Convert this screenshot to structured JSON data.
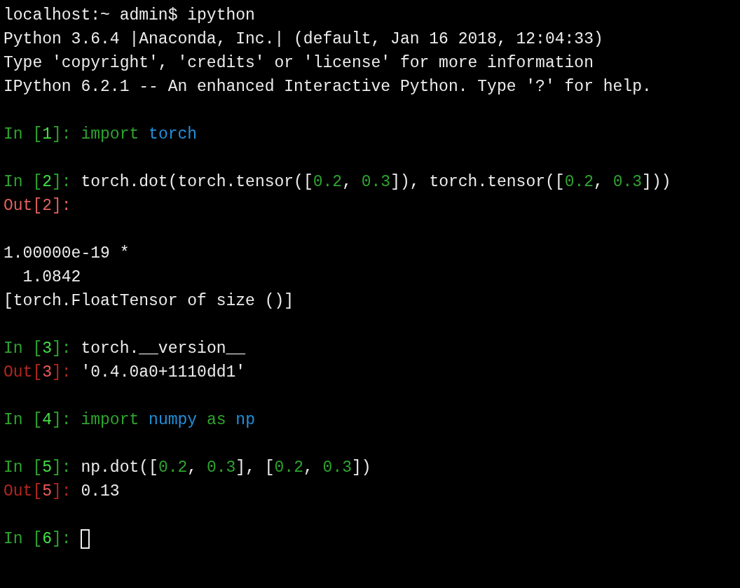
{
  "terminal": {
    "lines": [
      {
        "kind": "text",
        "segments": [
          {
            "kind": "plain",
            "text": "localhost:~ admin$ ipython"
          }
        ]
      },
      {
        "kind": "text",
        "segments": [
          {
            "kind": "plain",
            "text": "Python 3.6.4 |Anaconda, Inc.| (default, Jan 16 2018, 12:04:33)"
          }
        ]
      },
      {
        "kind": "text",
        "segments": [
          {
            "kind": "plain",
            "text": "Type 'copyright', 'credits' or 'license' for more information"
          }
        ]
      },
      {
        "kind": "text",
        "segments": [
          {
            "kind": "plain",
            "text": "IPython 6.2.1 -- An enhanced Interactive Python. Type '?' for help."
          }
        ]
      },
      {
        "kind": "blank"
      },
      {
        "kind": "text",
        "segments": [
          {
            "kind": "in",
            "text": "In ["
          },
          {
            "kind": "in_num",
            "text": "1"
          },
          {
            "kind": "in",
            "text": "]: "
          },
          {
            "kind": "keyword",
            "text": "import "
          },
          {
            "kind": "module",
            "text": "torch"
          }
        ]
      },
      {
        "kind": "blank"
      },
      {
        "kind": "text",
        "segments": [
          {
            "kind": "in",
            "text": "In ["
          },
          {
            "kind": "in_num",
            "text": "2"
          },
          {
            "kind": "in",
            "text": "]: "
          },
          {
            "kind": "plain",
            "text": "torch.dot(torch.tensor(["
          },
          {
            "kind": "number",
            "text": "0.2"
          },
          {
            "kind": "plain",
            "text": ", "
          },
          {
            "kind": "number",
            "text": "0.3"
          },
          {
            "kind": "plain",
            "text": "]), torch.tensor(["
          },
          {
            "kind": "number",
            "text": "0.2"
          },
          {
            "kind": "plain",
            "text": ", "
          },
          {
            "kind": "number",
            "text": "0.3"
          },
          {
            "kind": "plain",
            "text": "]))"
          }
        ]
      },
      {
        "kind": "text",
        "segments": [
          {
            "kind": "out_light",
            "text": "Out[2]:"
          }
        ]
      },
      {
        "kind": "blank"
      },
      {
        "kind": "text",
        "segments": [
          {
            "kind": "plain",
            "text": "1.00000e-19 *"
          }
        ]
      },
      {
        "kind": "text",
        "segments": [
          {
            "kind": "plain",
            "text": "  1.0842"
          }
        ]
      },
      {
        "kind": "text",
        "segments": [
          {
            "kind": "plain",
            "text": "[torch.FloatTensor of size ()]"
          }
        ]
      },
      {
        "kind": "blank"
      },
      {
        "kind": "text",
        "segments": [
          {
            "kind": "in",
            "text": "In ["
          },
          {
            "kind": "in_num",
            "text": "3"
          },
          {
            "kind": "in",
            "text": "]: "
          },
          {
            "kind": "plain",
            "text": "torch.__version__"
          }
        ]
      },
      {
        "kind": "text",
        "segments": [
          {
            "kind": "out",
            "text": "Out["
          },
          {
            "kind": "out_num",
            "text": "3"
          },
          {
            "kind": "out",
            "text": "]: "
          },
          {
            "kind": "plain",
            "text": "'0.4.0a0+1110dd1'"
          }
        ]
      },
      {
        "kind": "blank"
      },
      {
        "kind": "text",
        "segments": [
          {
            "kind": "in",
            "text": "In ["
          },
          {
            "kind": "in_num",
            "text": "4"
          },
          {
            "kind": "in",
            "text": "]: "
          },
          {
            "kind": "keyword",
            "text": "import "
          },
          {
            "kind": "module",
            "text": "numpy "
          },
          {
            "kind": "keyword",
            "text": "as "
          },
          {
            "kind": "module",
            "text": "np"
          }
        ]
      },
      {
        "kind": "blank"
      },
      {
        "kind": "text",
        "segments": [
          {
            "kind": "in",
            "text": "In ["
          },
          {
            "kind": "in_num",
            "text": "5"
          },
          {
            "kind": "in",
            "text": "]: "
          },
          {
            "kind": "plain",
            "text": "np.dot(["
          },
          {
            "kind": "number",
            "text": "0.2"
          },
          {
            "kind": "plain",
            "text": ", "
          },
          {
            "kind": "number",
            "text": "0.3"
          },
          {
            "kind": "plain",
            "text": "], ["
          },
          {
            "kind": "number",
            "text": "0.2"
          },
          {
            "kind": "plain",
            "text": ", "
          },
          {
            "kind": "number",
            "text": "0.3"
          },
          {
            "kind": "plain",
            "text": "])"
          }
        ]
      },
      {
        "kind": "text",
        "segments": [
          {
            "kind": "out",
            "text": "Out["
          },
          {
            "kind": "out_num",
            "text": "5"
          },
          {
            "kind": "out",
            "text": "]: "
          },
          {
            "kind": "plain",
            "text": "0.13"
          }
        ]
      },
      {
        "kind": "blank"
      },
      {
        "kind": "text",
        "cursor": true,
        "segments": [
          {
            "kind": "in",
            "text": "In ["
          },
          {
            "kind": "in_num",
            "text": "6"
          },
          {
            "kind": "in",
            "text": "]: "
          }
        ]
      }
    ]
  }
}
